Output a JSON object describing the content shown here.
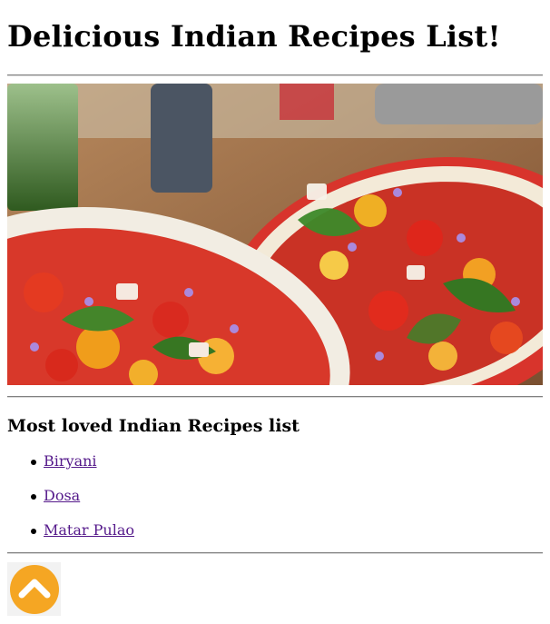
{
  "page": {
    "title": "Delicious Indian Recipes List!"
  },
  "hero_image": {
    "alt": "Two dishes of tomato salad with basil and purple flowers"
  },
  "recipes_section": {
    "heading": "Most loved Indian Recipes list",
    "items": [
      {
        "label": "Biryani"
      },
      {
        "label": "Dosa"
      },
      {
        "label": "Matar Pulao"
      }
    ]
  },
  "scroll_top": {
    "icon": "chevron-up-icon",
    "color": "#f5a623"
  }
}
